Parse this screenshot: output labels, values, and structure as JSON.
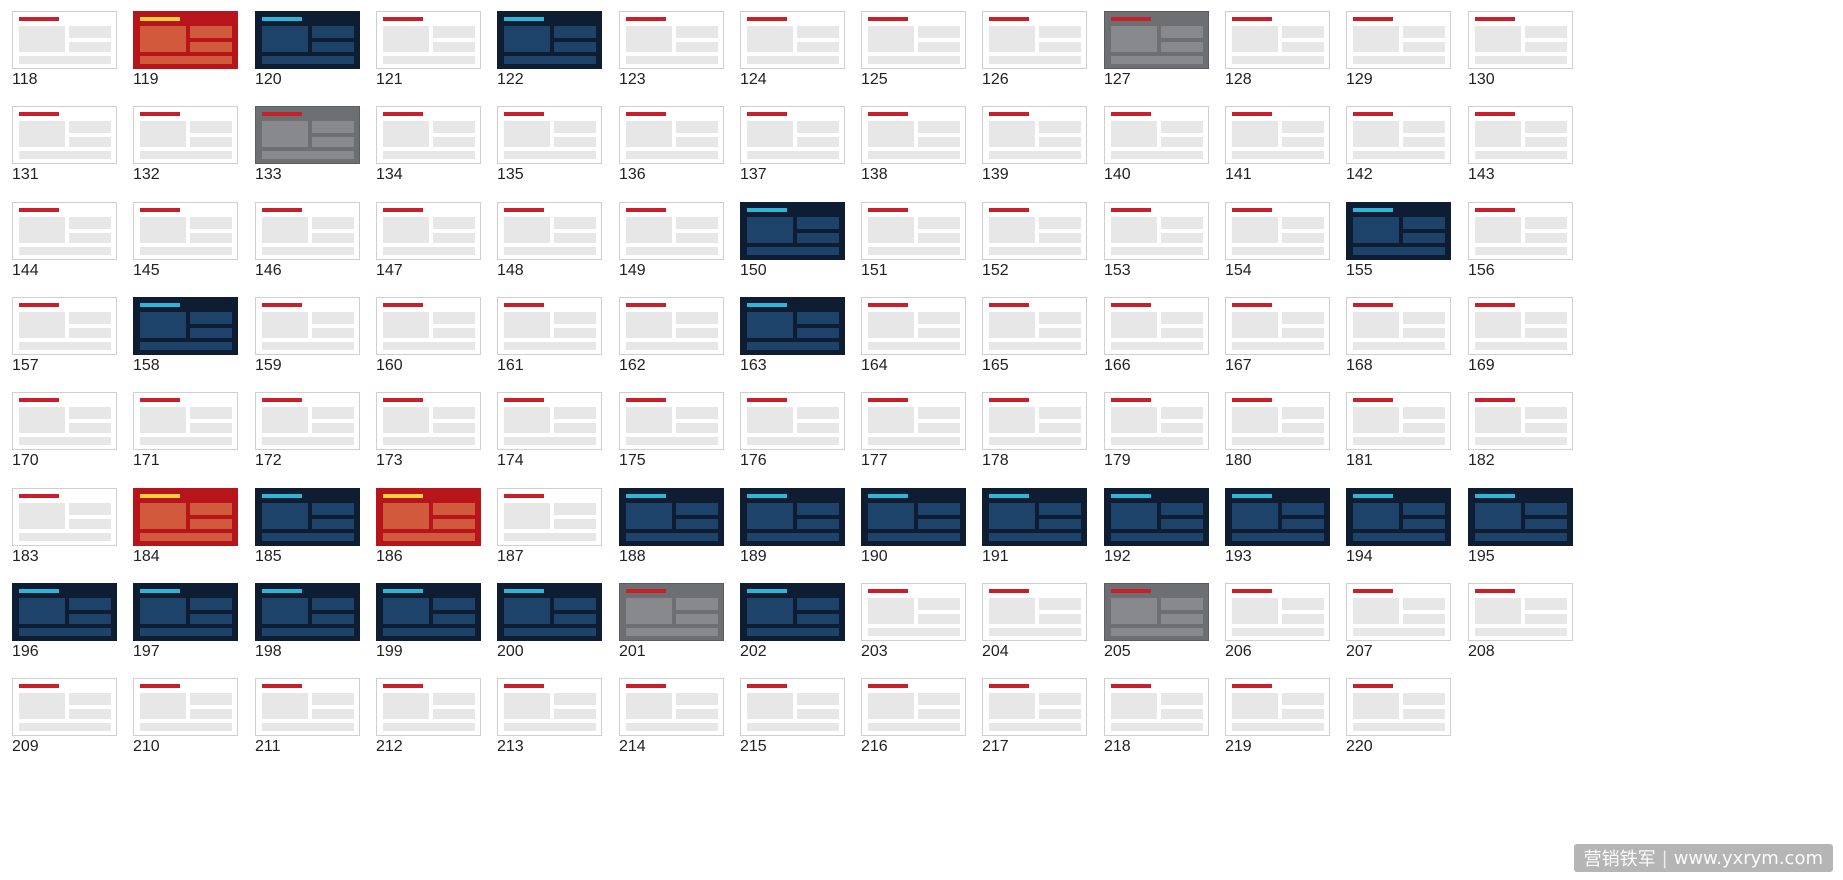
{
  "slides": [
    {
      "number": "118",
      "style": "light"
    },
    {
      "number": "119",
      "style": "red"
    },
    {
      "number": "120",
      "style": "dark"
    },
    {
      "number": "121",
      "style": "light"
    },
    {
      "number": "122",
      "style": "dark"
    },
    {
      "number": "123",
      "style": "light"
    },
    {
      "number": "124",
      "style": "light"
    },
    {
      "number": "125",
      "style": "light"
    },
    {
      "number": "126",
      "style": "light"
    },
    {
      "number": "127",
      "style": "photo"
    },
    {
      "number": "128",
      "style": "light"
    },
    {
      "number": "129",
      "style": "light"
    },
    {
      "number": "130",
      "style": "light"
    },
    {
      "number": "131",
      "style": "light"
    },
    {
      "number": "132",
      "style": "light"
    },
    {
      "number": "133",
      "style": "photo"
    },
    {
      "number": "134",
      "style": "light"
    },
    {
      "number": "135",
      "style": "light"
    },
    {
      "number": "136",
      "style": "light"
    },
    {
      "number": "137",
      "style": "light"
    },
    {
      "number": "138",
      "style": "light"
    },
    {
      "number": "139",
      "style": "light"
    },
    {
      "number": "140",
      "style": "light"
    },
    {
      "number": "141",
      "style": "light"
    },
    {
      "number": "142",
      "style": "light"
    },
    {
      "number": "143",
      "style": "light"
    },
    {
      "number": "144",
      "style": "light"
    },
    {
      "number": "145",
      "style": "light"
    },
    {
      "number": "146",
      "style": "light"
    },
    {
      "number": "147",
      "style": "light"
    },
    {
      "number": "148",
      "style": "light"
    },
    {
      "number": "149",
      "style": "light"
    },
    {
      "number": "150",
      "style": "dark"
    },
    {
      "number": "151",
      "style": "light"
    },
    {
      "number": "152",
      "style": "light"
    },
    {
      "number": "153",
      "style": "light"
    },
    {
      "number": "154",
      "style": "light"
    },
    {
      "number": "155",
      "style": "dark"
    },
    {
      "number": "156",
      "style": "light"
    },
    {
      "number": "157",
      "style": "light"
    },
    {
      "number": "158",
      "style": "dark"
    },
    {
      "number": "159",
      "style": "light"
    },
    {
      "number": "160",
      "style": "light"
    },
    {
      "number": "161",
      "style": "light"
    },
    {
      "number": "162",
      "style": "light"
    },
    {
      "number": "163",
      "style": "dark"
    },
    {
      "number": "164",
      "style": "light"
    },
    {
      "number": "165",
      "style": "light"
    },
    {
      "number": "166",
      "style": "light"
    },
    {
      "number": "167",
      "style": "light"
    },
    {
      "number": "168",
      "style": "light"
    },
    {
      "number": "169",
      "style": "light"
    },
    {
      "number": "170",
      "style": "light"
    },
    {
      "number": "171",
      "style": "light"
    },
    {
      "number": "172",
      "style": "light"
    },
    {
      "number": "173",
      "style": "light"
    },
    {
      "number": "174",
      "style": "light"
    },
    {
      "number": "175",
      "style": "light"
    },
    {
      "number": "176",
      "style": "light"
    },
    {
      "number": "177",
      "style": "light"
    },
    {
      "number": "178",
      "style": "light"
    },
    {
      "number": "179",
      "style": "light"
    },
    {
      "number": "180",
      "style": "light"
    },
    {
      "number": "181",
      "style": "light"
    },
    {
      "number": "182",
      "style": "light"
    },
    {
      "number": "183",
      "style": "light"
    },
    {
      "number": "184",
      "style": "red"
    },
    {
      "number": "185",
      "style": "dark"
    },
    {
      "number": "186",
      "style": "red"
    },
    {
      "number": "187",
      "style": "light"
    },
    {
      "number": "188",
      "style": "dark"
    },
    {
      "number": "189",
      "style": "dark"
    },
    {
      "number": "190",
      "style": "dark"
    },
    {
      "number": "191",
      "style": "dark"
    },
    {
      "number": "192",
      "style": "dark"
    },
    {
      "number": "193",
      "style": "dark"
    },
    {
      "number": "194",
      "style": "dark"
    },
    {
      "number": "195",
      "style": "dark"
    },
    {
      "number": "196",
      "style": "dark"
    },
    {
      "number": "197",
      "style": "dark"
    },
    {
      "number": "198",
      "style": "dark"
    },
    {
      "number": "199",
      "style": "dark"
    },
    {
      "number": "200",
      "style": "dark"
    },
    {
      "number": "201",
      "style": "photo"
    },
    {
      "number": "202",
      "style": "dark"
    },
    {
      "number": "203",
      "style": "light"
    },
    {
      "number": "204",
      "style": "light"
    },
    {
      "number": "205",
      "style": "photo"
    },
    {
      "number": "206",
      "style": "light"
    },
    {
      "number": "207",
      "style": "light"
    },
    {
      "number": "208",
      "style": "light"
    },
    {
      "number": "209",
      "style": "light"
    },
    {
      "number": "210",
      "style": "light"
    },
    {
      "number": "211",
      "style": "light"
    },
    {
      "number": "212",
      "style": "light"
    },
    {
      "number": "213",
      "style": "light"
    },
    {
      "number": "214",
      "style": "light"
    },
    {
      "number": "215",
      "style": "light"
    },
    {
      "number": "216",
      "style": "light"
    },
    {
      "number": "217",
      "style": "light"
    },
    {
      "number": "218",
      "style": "light"
    },
    {
      "number": "219",
      "style": "light"
    },
    {
      "number": "220",
      "style": "light"
    }
  ],
  "watermark": {
    "name": "营销铁军",
    "separator": "|",
    "site": "www.yxrym.com"
  }
}
